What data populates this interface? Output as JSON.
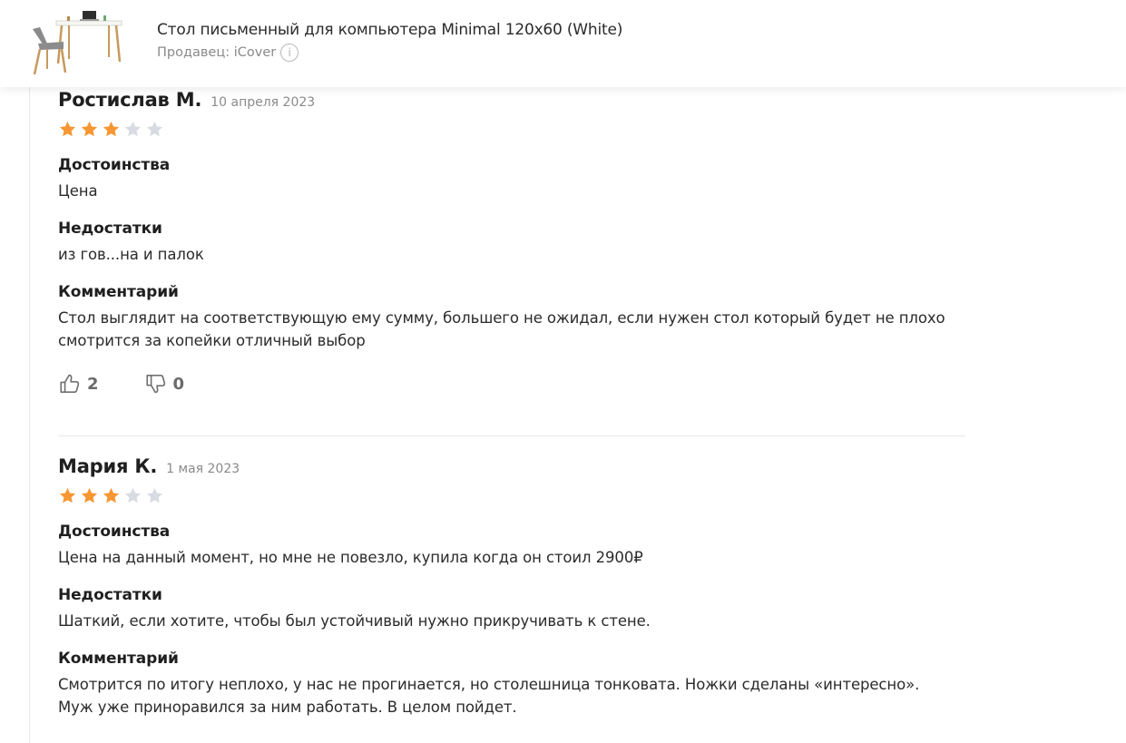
{
  "header": {
    "product_title": "Стол письменный для компьютера Minimal 120x60 (White)",
    "seller_label": "Продавец: iCover",
    "info_icon": "i"
  },
  "reviews": [
    {
      "author": "Ростислав М.",
      "date": "10 апреля 2023",
      "rating": 3,
      "rating_max": 5,
      "pros_title": "Достоинства",
      "pros": "Цена",
      "cons_title": "Недостатки",
      "cons": "из гов...на и палок",
      "comment_title": "Комментарий",
      "comment": "Стол выглядит на соответствующую ему сумму, большего не ожидал, если нужен стол который будет не плохо смотрится за копейки отличный выбор",
      "likes": "2",
      "dislikes": "0"
    },
    {
      "author": "Мария К.",
      "date": "1 мая 2023",
      "rating": 3,
      "rating_max": 5,
      "pros_title": "Достоинства",
      "pros": "Цена на данный момент, но мне не повезло, купила когда он стоил 2900₽",
      "cons_title": "Недостатки",
      "cons": "Шаткий, если хотите, чтобы был устойчивый нужно прикручивать к стене.",
      "comment_title": "Комментарий",
      "comment": "Смотрится по итогу неплохо, у нас не прогинается, но столешница тонковата. Ножки сделаны «интересно». Муж уже приноравился за ним работать. В целом пойдет."
    }
  ],
  "icons": {
    "thumbs_up": "thumbs-up-icon",
    "thumbs_down": "thumbs-down-icon",
    "star": "star-icon",
    "info": "info-icon"
  },
  "colors": {
    "star_filled": "#f79633",
    "star_empty": "#d8dbe2"
  }
}
